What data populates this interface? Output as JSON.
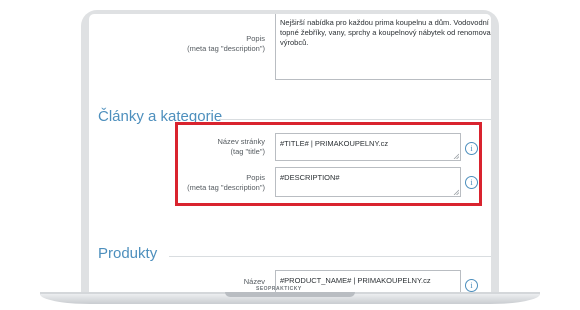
{
  "top_field": {
    "label_line1": "Popis",
    "label_line2": "(meta tag \"description\")",
    "value_line1": "Nejširší nabídka pro každou prima koupelnu a dům. Vodovodní b",
    "value_line2": "topné žebříky, vany, sprchy a koupelnový nábytek od renomova",
    "value_line3": "výrobců."
  },
  "articles_section": {
    "title": "Články a kategorie",
    "page_name_label_line1": "Název stránky",
    "page_name_label_line2": "(tag \"title\")",
    "page_name_value": "#TITLE# | PRIMAKOUPELNY.cz",
    "description_label_line1": "Popis",
    "description_label_line2": "(meta tag \"description\")",
    "description_value": "#DESCRIPTION#",
    "info_glyph": "i",
    "highlight_color": "#d9232e"
  },
  "products_section": {
    "title": "Produkty",
    "name_label": "Název",
    "name_value": "#PRODUCT_NAME# | PRIMAKOUPELNY.cz",
    "info_glyph": "i"
  },
  "device": {
    "brand": "SEOPRAKTICKY"
  },
  "colors": {
    "accent": "#4d8fbd",
    "highlight": "#d9232e",
    "border": "#b9bdc2"
  }
}
